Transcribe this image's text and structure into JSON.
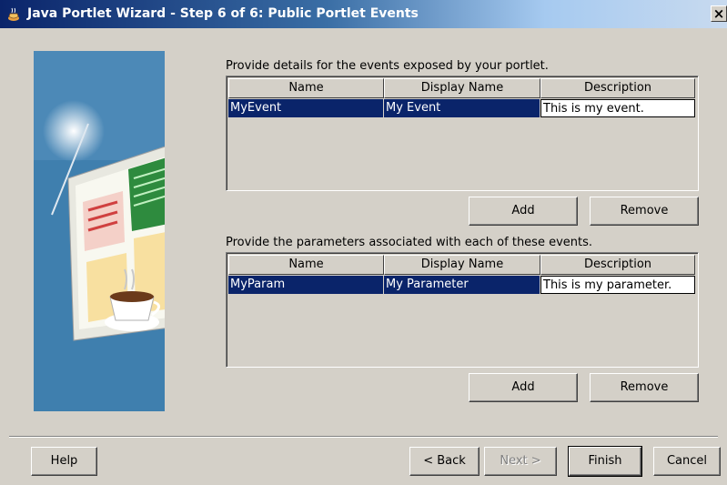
{
  "window": {
    "title": "Java Portlet Wizard - Step 6 of 6: Public Portlet Events",
    "close_glyph": "×"
  },
  "events": {
    "instruction": "Provide details for the events exposed by your portlet.",
    "columns": [
      "Name",
      "Display Name",
      "Description"
    ],
    "rows": [
      {
        "name": "MyEvent",
        "display_name": "My Event",
        "description": "This is my event."
      }
    ],
    "add_label": "Add",
    "remove_label": "Remove"
  },
  "parameters": {
    "instruction": "Provide the parameters associated with each of these events.",
    "columns": [
      "Name",
      "Display Name",
      "Description"
    ],
    "rows": [
      {
        "name": "MyParam",
        "display_name": "My Parameter",
        "description": "This is my parameter."
      }
    ],
    "add_label": "Add",
    "remove_label": "Remove"
  },
  "footer": {
    "help_label": "Help",
    "back_label": "< Back",
    "next_label": "Next >",
    "finish_label": "Finish",
    "cancel_label": "Cancel"
  },
  "colors": {
    "selection": "#0a246a",
    "dialog": "#d4d0c8",
    "art_background": "#3f7fae"
  }
}
